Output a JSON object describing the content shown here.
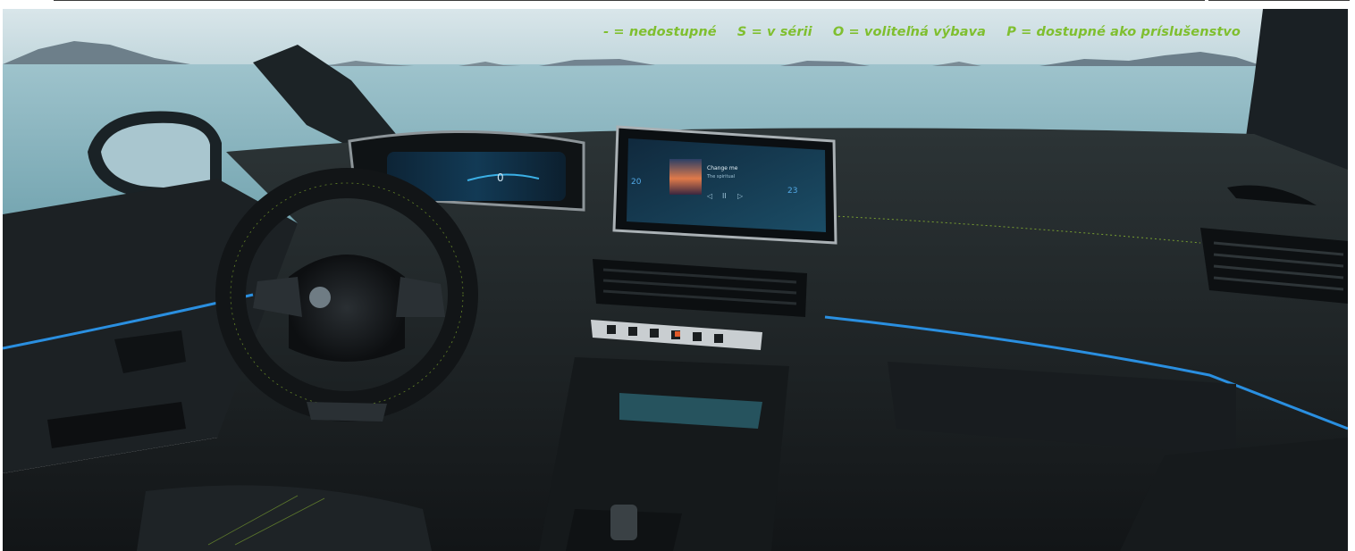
{
  "legend": {
    "unavailable": "- = nedostupné",
    "standard": "S = v sérii",
    "optional": "O =  voliteľná výbava",
    "accessory": "P = dostupné ako príslušenstvo"
  },
  "screen": {
    "track_title": "Change me",
    "track_artist": "The spiritual",
    "temp_left": "20",
    "temp_right": "23"
  },
  "colors": {
    "legend": "#7fbf2f",
    "ambient_light": "#2a8fe0",
    "stitching": "#9acd32"
  }
}
